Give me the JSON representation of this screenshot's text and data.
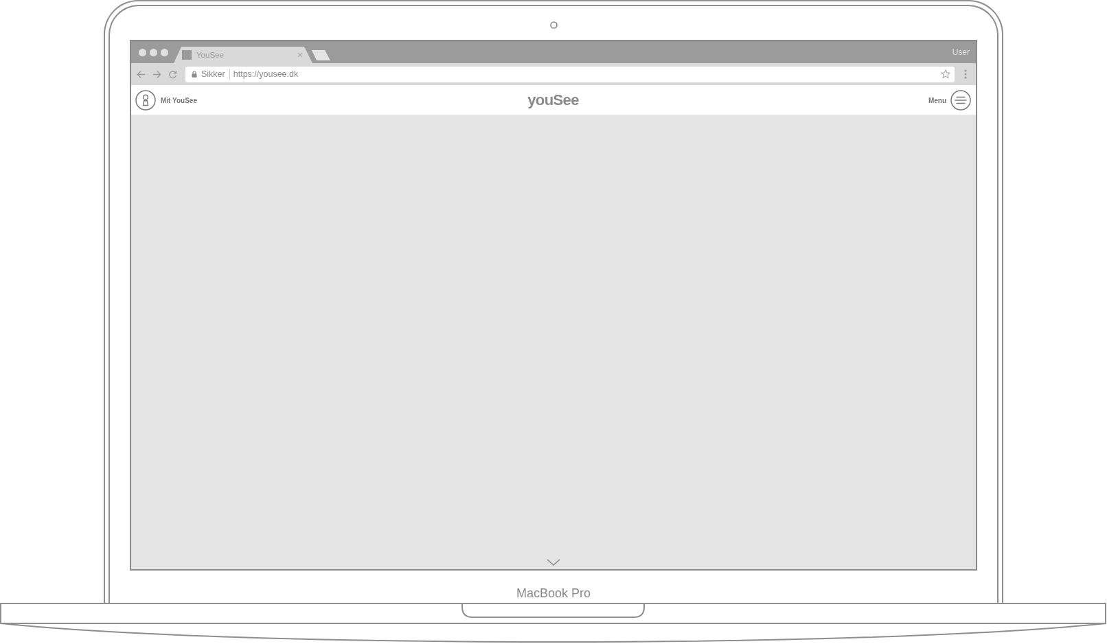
{
  "browser": {
    "tabs": [
      {
        "title": "YouSee",
        "selected": true
      }
    ],
    "profile_label": "User",
    "address_bar": {
      "security_label": "Sikker",
      "url": "https://yousee.dk"
    }
  },
  "site_header": {
    "account_link": "Mit YouSee",
    "logo": "youSee",
    "menu_label": "Menu"
  },
  "laptop": {
    "model_label": "MacBook Pro"
  }
}
